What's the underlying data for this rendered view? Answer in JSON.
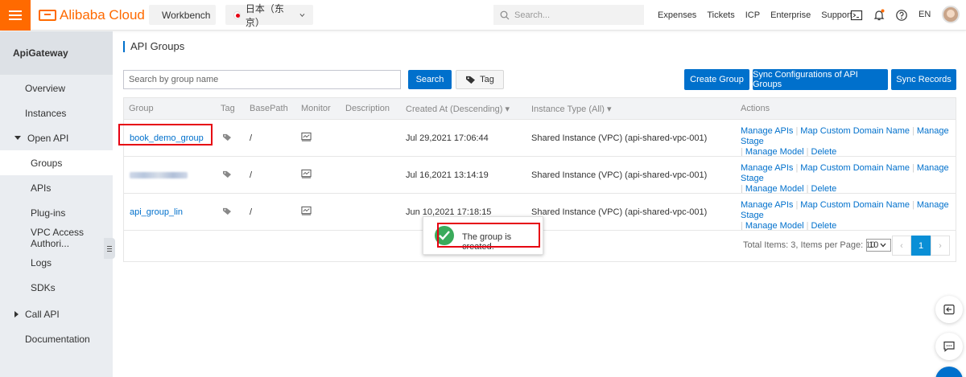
{
  "topbar": {
    "brand": "Alibaba Cloud",
    "workbench": "Workbench",
    "region": "日本（东京）",
    "search_placeholder": "Search...",
    "links": [
      "Expenses",
      "Tickets",
      "ICP",
      "Enterprise",
      "Support"
    ],
    "language": "EN",
    "brand_color": "#ff6a00"
  },
  "sidebar": {
    "title": "ApiGateway",
    "items": [
      {
        "label": "Overview"
      },
      {
        "label": "Instances"
      },
      {
        "label": "Open API",
        "expanded": true
      },
      {
        "label": "Groups",
        "active": true
      },
      {
        "label": "APIs"
      },
      {
        "label": "Plug-ins"
      },
      {
        "label": "VPC Access Authori..."
      },
      {
        "label": "Logs"
      },
      {
        "label": "SDKs"
      },
      {
        "label": "Call API",
        "expanded": false
      },
      {
        "label": "Documentation"
      }
    ]
  },
  "main": {
    "title": "API Groups",
    "search_placeholder": "Search by group name",
    "search_button": "Search",
    "tag_button": "Tag",
    "create_button": "Create Group",
    "sync_button": "Sync Configurations of API Groups",
    "records_button": "Sync Records",
    "accent_color": "#0070cc",
    "columns": [
      "Group",
      "Tag",
      "BasePath",
      "Monitor",
      "Description",
      "Created At (Descending)",
      "Instance Type (All)",
      "Actions"
    ],
    "rows": [
      {
        "group": "book_demo_group",
        "basepath": "/",
        "created": "Jul 29,2021 17:06:44",
        "instance": "Shared Instance (VPC)  (api-shared-vpc-001)"
      },
      {
        "group": "",
        "basepath": "/",
        "created": "Jul 16,2021 13:14:19",
        "instance": "Shared Instance (VPC)  (api-shared-vpc-001)"
      },
      {
        "group": "api_group_lin",
        "basepath": "/",
        "created": "Jun 10,2021 17:18:15",
        "instance": "Shared Instance (VPC)  (api-shared-vpc-001)"
      }
    ],
    "actions": {
      "manage_apis": "Manage APIs",
      "map_domain": "Map Custom Domain Name",
      "manage_stage": "Manage Stage",
      "manage_model": "Manage Model",
      "delete": "Delete"
    },
    "pager": {
      "summary": "Total Items: 3, Items per Page: 10",
      "page_size": "10",
      "current_page": "1",
      "prev": "‹",
      "next": "›"
    }
  },
  "toast": {
    "message": "The group is created.",
    "status_color": "#3aab5b"
  }
}
